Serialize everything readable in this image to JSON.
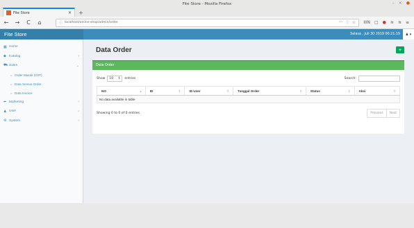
{
  "window": {
    "title": "Fite Store - Mozilla Firefox",
    "controls": [
      "–",
      "×",
      "●"
    ]
  },
  "browser": {
    "tab_title": "Fite Store",
    "tab_close": "×",
    "new_tab": "+",
    "back": "←",
    "forward": "→",
    "reload": "C",
    "home": "⌂",
    "url_info": "ⓘ",
    "url": "localhost/online-shop/admin/order",
    "page_actions": [
      "···",
      "♡",
      "☆"
    ],
    "toolbar": [
      "IIIN",
      "□",
      "●",
      "≋",
      "≋",
      "≡"
    ]
  },
  "app": {
    "brand": "Fite Store",
    "datetime": "Selasa , Juli 30 2019 00:21:19",
    "user_menu": "♟ ▾"
  },
  "sidebar": {
    "items": [
      {
        "icon": "▦",
        "label": "Home",
        "chev": ""
      },
      {
        "icon": "◆",
        "label": "Katalog",
        "chev": "›"
      },
      {
        "icon": "⛟",
        "label": "Sales",
        "chev": "⌄"
      }
    ],
    "sales_subitems": [
      {
        "icon": "○",
        "label": "Order Masuk (C0T)"
      },
      {
        "icon": "○",
        "label": "Data Semua Order"
      },
      {
        "icon": "○",
        "label": "Data Invoice"
      }
    ],
    "items_after": [
      {
        "icon": "➦",
        "label": "Marketing",
        "chev": "‹"
      },
      {
        "icon": "♟",
        "label": "User",
        "chev": "‹"
      },
      {
        "icon": "⚙",
        "label": "System",
        "chev": "‹"
      }
    ]
  },
  "main": {
    "title": "Data Order",
    "add_button": "+",
    "box_title": "Data Order",
    "show_label": "Show",
    "entries_value": "10",
    "entries_label": "entries",
    "search_label": "Search:",
    "columns": [
      "NO",
      "ID",
      "ID User",
      "Tanggal Order",
      "Status",
      "Aksi"
    ],
    "sort_icons": [
      "▴",
      "⇕",
      "⇕",
      "⇕",
      "⇕",
      "⇕"
    ],
    "empty_message": "No data available in table",
    "info": "Showing 0 to 0 of 0 entries",
    "pager": [
      "Previous",
      "Next"
    ]
  }
}
